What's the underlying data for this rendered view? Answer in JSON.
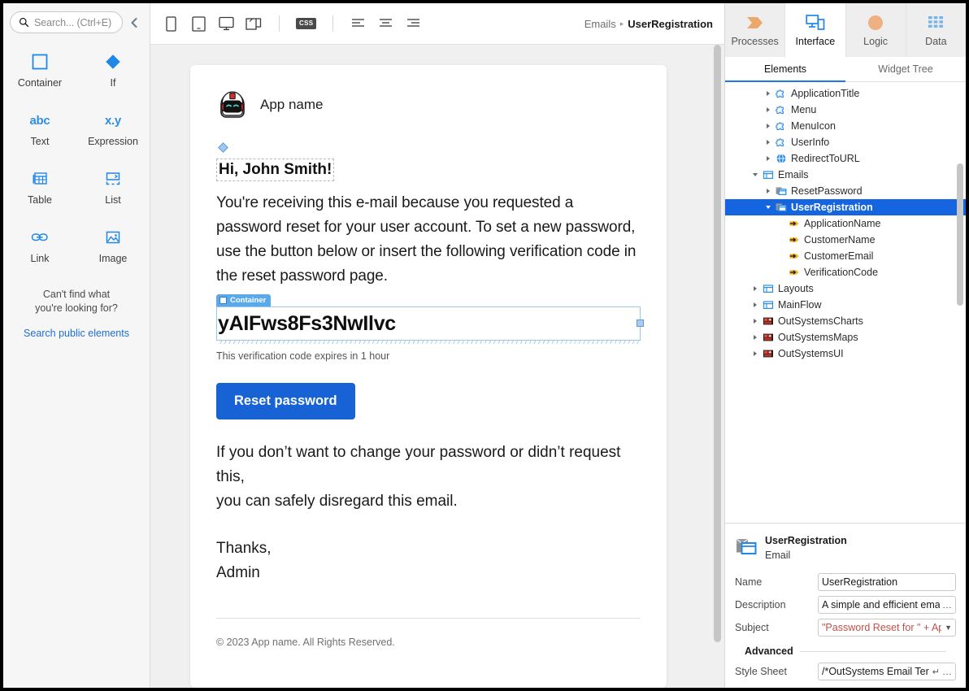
{
  "toolbox": {
    "search_placeholder": "Search... (Ctrl+E)",
    "collapse_label": "‹",
    "items": [
      {
        "label": "Container",
        "icon": "container-icon"
      },
      {
        "label": "If",
        "icon": "if-icon"
      },
      {
        "label": "Text",
        "icon": "text-icon",
        "glyph": "abc"
      },
      {
        "label": "Expression",
        "icon": "expression-icon",
        "glyph": "x.y"
      },
      {
        "label": "Table",
        "icon": "table-icon"
      },
      {
        "label": "List",
        "icon": "list-icon"
      },
      {
        "label": "Link",
        "icon": "link-icon"
      },
      {
        "label": "Image",
        "icon": "image-icon"
      }
    ],
    "hint_line1": "Can't find what",
    "hint_line2": "you're looking for?",
    "hint_link": "Search public elements"
  },
  "toolbar": {
    "devices": [
      "phone-icon",
      "tablet-icon",
      "desktop-icon",
      "responsive-icon"
    ],
    "css_label": "CSS",
    "align": [
      "align-left-icon",
      "align-center-icon",
      "align-right-icon"
    ],
    "breadcrumb_parent": "Emails",
    "breadcrumb_separator": "▸",
    "breadcrumb_current": "UserRegistration"
  },
  "email": {
    "brand_name": "App name",
    "greeting": "Hi, John Smith!",
    "body": "You're receiving this e-mail because you requested a password reset for your user account. To set a new password, use the button below or insert the following verification code in the reset password page.",
    "container_tag": "Container",
    "verification_code": "yAIFws8Fs3NwIlvc",
    "expires_note": "This verification code expires in 1 hour",
    "cta_label": "Reset password",
    "closing_line1": "If you don’t want to change your password or didn’t request this,",
    "closing_line2": "you can safely disregard this email.",
    "sign_off": "Thanks,",
    "sign_name": "Admin",
    "copyright": "© 2023 App name. All Rights Reserved.",
    "accent_color": "#1763d6"
  },
  "right_panel": {
    "main_tabs": [
      {
        "label": "Processes",
        "icon": "processes-icon",
        "active": false
      },
      {
        "label": "Interface",
        "icon": "interface-icon",
        "active": true
      },
      {
        "label": "Logic",
        "icon": "logic-icon",
        "active": false
      },
      {
        "label": "Data",
        "icon": "data-icon",
        "active": false
      }
    ],
    "sub_tabs": [
      {
        "label": "Elements",
        "active": true
      },
      {
        "label": "Widget Tree",
        "active": false
      }
    ],
    "tree": [
      {
        "label": "ApplicationTitle",
        "icon": "block-icon",
        "indent": 2,
        "twisty": "closed",
        "selected": false
      },
      {
        "label": "Menu",
        "icon": "block-icon",
        "indent": 2,
        "twisty": "closed",
        "selected": false
      },
      {
        "label": "MenuIcon",
        "icon": "block-icon",
        "indent": 2,
        "twisty": "closed",
        "selected": false
      },
      {
        "label": "UserInfo",
        "icon": "block-icon",
        "indent": 2,
        "twisty": "closed",
        "selected": false
      },
      {
        "label": "RedirectToURL",
        "icon": "globe-icon",
        "indent": 2,
        "twisty": "closed",
        "selected": false
      },
      {
        "label": "Emails",
        "icon": "folder-icon",
        "indent": 1,
        "twisty": "open",
        "selected": false
      },
      {
        "label": "ResetPassword",
        "icon": "email-icon",
        "indent": 2,
        "twisty": "closed",
        "selected": false
      },
      {
        "label": "UserRegistration",
        "icon": "email-icon",
        "indent": 2,
        "twisty": "open",
        "selected": true
      },
      {
        "label": "ApplicationName",
        "icon": "input-param-icon",
        "indent": 3,
        "twisty": "none",
        "selected": false
      },
      {
        "label": "CustomerName",
        "icon": "input-param-icon",
        "indent": 3,
        "twisty": "none",
        "selected": false
      },
      {
        "label": "CustomerEmail",
        "icon": "input-param-icon",
        "indent": 3,
        "twisty": "none",
        "selected": false
      },
      {
        "label": "VerificationCode",
        "icon": "input-param-icon",
        "indent": 3,
        "twisty": "none",
        "selected": false
      },
      {
        "label": "Layouts",
        "icon": "folder-icon",
        "indent": 1,
        "twisty": "closed",
        "selected": false
      },
      {
        "label": "MainFlow",
        "icon": "folder-icon",
        "indent": 1,
        "twisty": "closed",
        "selected": false
      },
      {
        "label": "OutSystemsCharts",
        "icon": "module-icon",
        "indent": 1,
        "twisty": "closed",
        "selected": false
      },
      {
        "label": "OutSystemsMaps",
        "icon": "module-icon",
        "indent": 1,
        "twisty": "closed",
        "selected": false
      },
      {
        "label": "OutSystemsUI",
        "icon": "module-icon",
        "indent": 1,
        "twisty": "closed",
        "selected": false
      }
    ],
    "properties": {
      "title": "UserRegistration",
      "subtitle": "Email",
      "rows": [
        {
          "label": "Name",
          "value": "UserRegistration",
          "kind": "text"
        },
        {
          "label": "Description",
          "value": "A simple and efficient emai",
          "kind": "text-ellipsis"
        },
        {
          "label": "Subject",
          "value": "\"Password Reset for \" + App",
          "kind": "expression-dropdown"
        }
      ],
      "advanced_label": "Advanced",
      "advanced_rows": [
        {
          "label": "Style Sheet",
          "value": "/*OutSystems Email Ter",
          "kind": "multiline-ellipsis"
        }
      ]
    }
  }
}
